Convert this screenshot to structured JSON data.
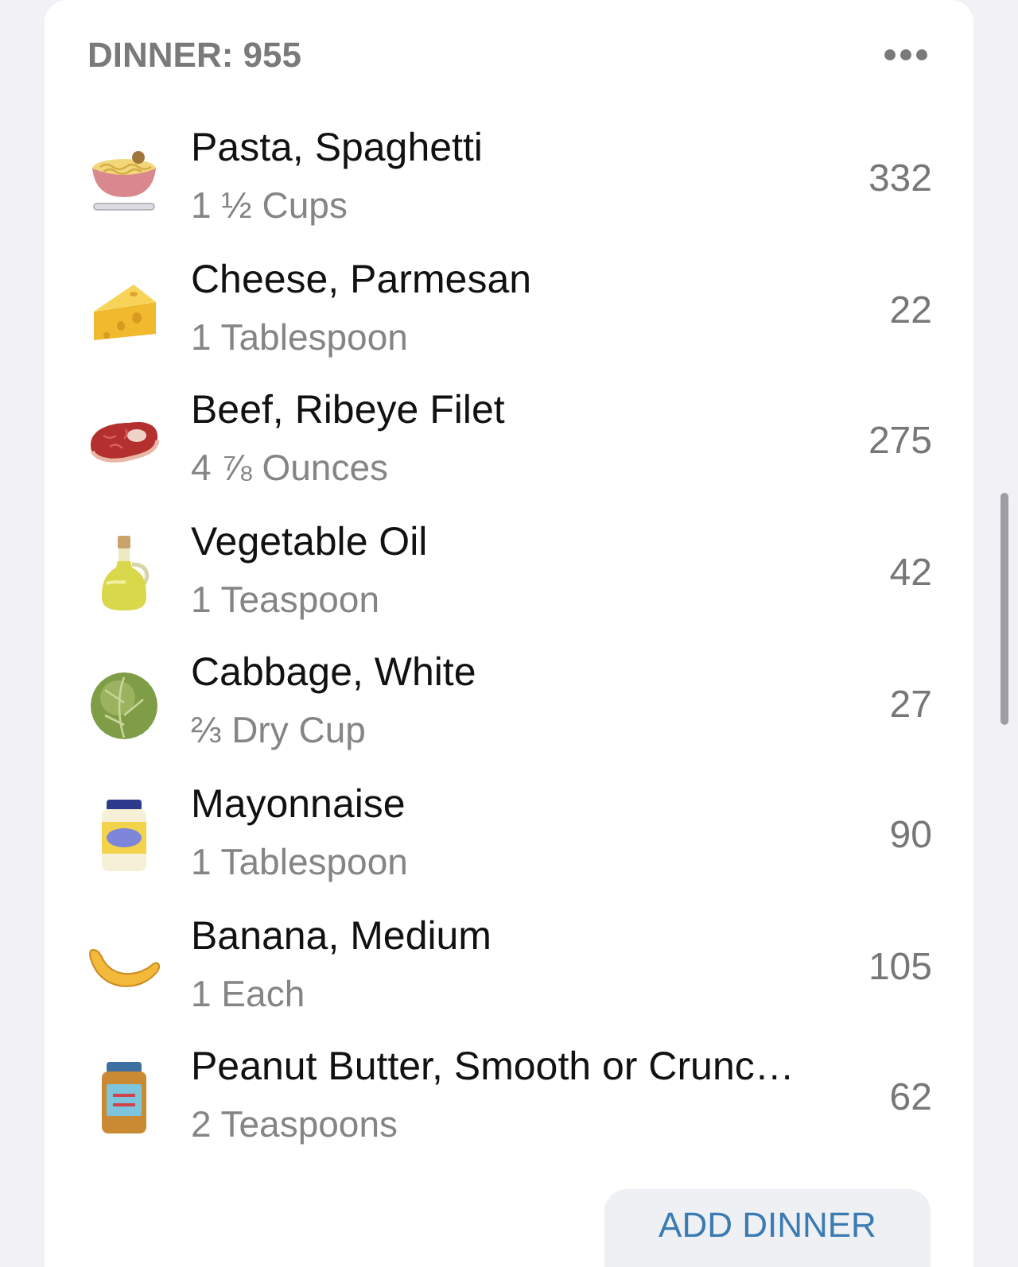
{
  "meal": {
    "title": "DINNER: 955"
  },
  "items": [
    {
      "name": "Pasta, Spaghetti",
      "amount": "1 ½ Cups",
      "calories": "332"
    },
    {
      "name": "Cheese, Parmesan",
      "amount": "1 Tablespoon",
      "calories": "22"
    },
    {
      "name": "Beef, Ribeye Filet",
      "amount": "4 ⅞ Ounces",
      "calories": "275"
    },
    {
      "name": "Vegetable Oil",
      "amount": "1 Teaspoon",
      "calories": "42"
    },
    {
      "name": "Cabbage, White",
      "amount": "⅔ Dry Cup",
      "calories": "27"
    },
    {
      "name": "Mayonnaise",
      "amount": "1 Tablespoon",
      "calories": "90"
    },
    {
      "name": "Banana, Medium",
      "amount": "1 Each",
      "calories": "105"
    },
    {
      "name": "Peanut Butter, Smooth or Crunc…",
      "amount": "2 Teaspoons",
      "calories": "62"
    }
  ],
  "add_button": {
    "label": "ADD DINNER"
  }
}
